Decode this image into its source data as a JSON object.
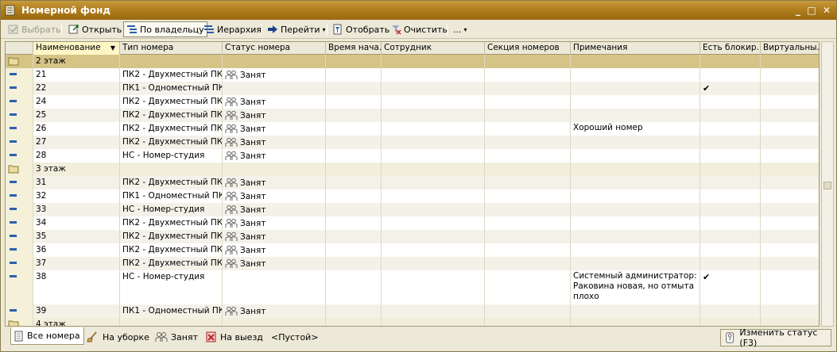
{
  "window": {
    "title": "Номерной фонд",
    "minimize": "_",
    "maximize": "□",
    "close": "✕"
  },
  "toolbar": {
    "select": "Выбрать",
    "open": "Открыть",
    "by_owner": "По владельцу",
    "hierarchy": "Иерархия",
    "goto": "Перейти",
    "filter": "Отобрать",
    "clear": "Очистить",
    "more": "..."
  },
  "table": {
    "columns": [
      "Наименование",
      "Тип номера",
      "Статус номера",
      "Время нача...",
      "Сотрудник",
      "Секция номеров",
      "Примечания",
      "Есть блокир...",
      "Виртуальны..."
    ],
    "rows": [
      {
        "kind": "group",
        "name": "2 этаж",
        "type": "",
        "status": "",
        "note": "",
        "blocked": ""
      },
      {
        "kind": "item",
        "name": "21",
        "type": "ПК2 - Двухместный ПК",
        "status": "Занят",
        "note": "",
        "blocked": ""
      },
      {
        "kind": "item",
        "name": "22",
        "type": "ПК1 - Одноместный ПК",
        "status": "",
        "note": "",
        "blocked": "✔"
      },
      {
        "kind": "item",
        "name": "24",
        "type": "ПК2 - Двухместный ПК",
        "status": "Занят",
        "note": "",
        "blocked": ""
      },
      {
        "kind": "item",
        "name": "25",
        "type": "ПК2 - Двухместный ПК",
        "status": "Занят",
        "note": "",
        "blocked": ""
      },
      {
        "kind": "item",
        "name": "26",
        "type": "ПК2 - Двухместный ПК",
        "status": "Занят",
        "note": "Хороший номер",
        "blocked": ""
      },
      {
        "kind": "item",
        "name": "27",
        "type": "ПК2 - Двухместный ПК",
        "status": "Занят",
        "note": "",
        "blocked": ""
      },
      {
        "kind": "item",
        "name": "28",
        "type": "НС - Номер-студия",
        "status": "Занят",
        "note": "",
        "blocked": ""
      },
      {
        "kind": "group",
        "name": "3 этаж",
        "type": "",
        "status": "",
        "note": "",
        "blocked": ""
      },
      {
        "kind": "item",
        "name": "31",
        "type": "ПК2 - Двухместный ПК",
        "status": "Занят",
        "note": "",
        "blocked": ""
      },
      {
        "kind": "item",
        "name": "32",
        "type": "ПК1 - Одноместный ПК",
        "status": "Занят",
        "note": "",
        "blocked": ""
      },
      {
        "kind": "item",
        "name": "33",
        "type": "НС - Номер-студия",
        "status": "Занят",
        "note": "",
        "blocked": ""
      },
      {
        "kind": "item",
        "name": "34",
        "type": "ПК2 - Двухместный ПК",
        "status": "Занят",
        "note": "",
        "blocked": ""
      },
      {
        "kind": "item",
        "name": "35",
        "type": "ПК2 - Двухместный ПК",
        "status": "Занят",
        "note": "",
        "blocked": ""
      },
      {
        "kind": "item",
        "name": "36",
        "type": "ПК2 - Двухместный ПК",
        "status": "Занят",
        "note": "",
        "blocked": ""
      },
      {
        "kind": "item",
        "name": "37",
        "type": "ПК2 - Двухместный ПК",
        "status": "Занят",
        "note": "",
        "blocked": ""
      },
      {
        "kind": "item",
        "name": "38",
        "type": "НС - Номер-студия",
        "status": "",
        "note": "Системный администратор: Раковина новая, но отмыта плохо",
        "blocked": "✔"
      },
      {
        "kind": "item",
        "name": "39",
        "type": "ПК1 - Одноместный ПК",
        "status": "Занят",
        "note": "",
        "blocked": ""
      },
      {
        "kind": "group",
        "name": "4 этаж",
        "type": "",
        "status": "",
        "note": "",
        "blocked": ""
      }
    ]
  },
  "bottom_tabs": [
    "Все номера",
    "На уборке",
    "Занят",
    "На выезд",
    "<Пустой>"
  ],
  "change_status": "Изменить статус (F3)",
  "colors": {
    "title_bar": "#b07e1c",
    "selected_row": "#d6c487",
    "row_icon": "#2b5fb0"
  }
}
